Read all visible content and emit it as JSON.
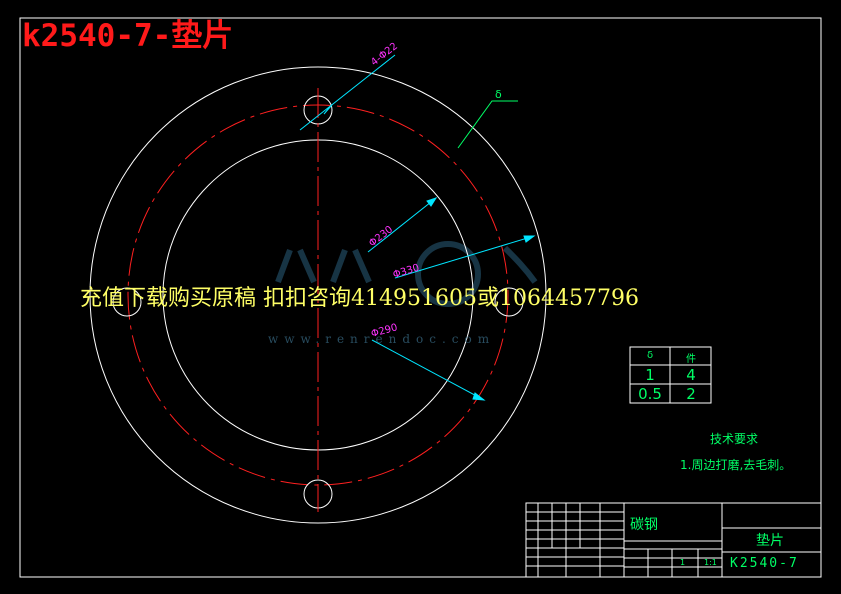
{
  "title": "k2540-7-垫片",
  "overlay_text": "充值下载购买原稿 扣扣咨询414951605或1064457796",
  "watermark": "www.renrendoc.com",
  "dimensions": {
    "holes": "4-Φ22",
    "thickness": "δ",
    "inner_dia": "Φ230",
    "pitch_dia": "Φ330",
    "outer_dia": "Φ290"
  },
  "spec_table": {
    "headers": [
      "δ",
      "件"
    ],
    "rows": [
      [
        "1",
        "4"
      ],
      [
        "0.5",
        "2"
      ]
    ]
  },
  "tech_requirements": {
    "heading": "技术要求",
    "item": "1.周边打磨,去毛刺。"
  },
  "title_block": {
    "material": "碳钢",
    "part_name": "垫片",
    "drawing_no": "K2540-7",
    "quantity": "1",
    "scale": "1:1"
  },
  "colors": {
    "background": "#000000",
    "title": "#ff1a1a",
    "geometry": "#ffffff",
    "centerline": "#ff2020",
    "dimension": "#00e5ff",
    "dim_text": "#ff33ff",
    "annotation": "#00ff66",
    "overlay": "#ffff66"
  }
}
